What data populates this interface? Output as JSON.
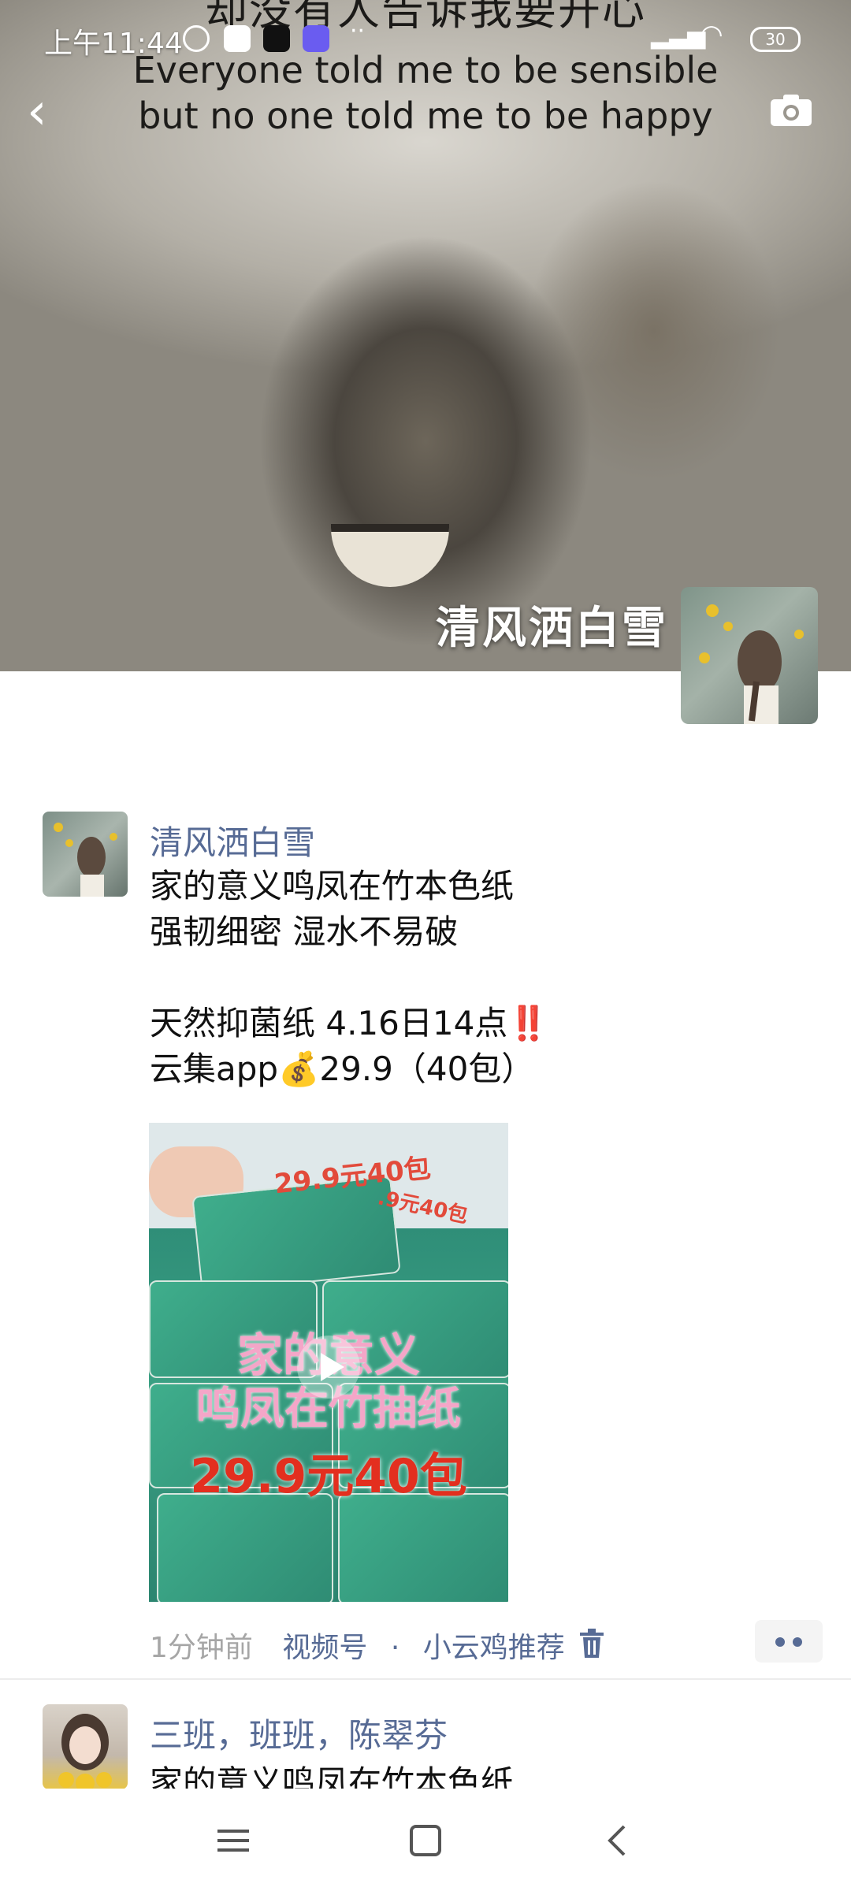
{
  "status_bar": {
    "time": "上午11:44",
    "battery": "30"
  },
  "cover": {
    "top_text": "却没有人告诉我要开心",
    "caption_line1": "Everyone told me to be sensible",
    "caption_line2": "but no one told me to be happy",
    "user_name": "清风洒白雪"
  },
  "post": {
    "author": "清风洒白雪",
    "text": "家的意义鸣凤在竹本色纸\n强韧细密 湿水不易破\n\n天然抑菌纸 4.16日14点‼️\n云集app💰29.9（40包）",
    "video": {
      "price_tag": "29.9元40包",
      "price_tag_small": ".9元40包",
      "line1": "家的意义",
      "line2": "鸣凤在竹抽纸",
      "line3": "29.9元40包"
    },
    "time": "1分钟前",
    "source": "视频号",
    "channel": "小云鸡推荐"
  },
  "post2": {
    "author": "三班，班班，陈翠芬",
    "text": "家的意义鸣凤在竹本色纸"
  },
  "colors": {
    "link": "#576b95",
    "meta_gray": "#a6a6a6"
  }
}
